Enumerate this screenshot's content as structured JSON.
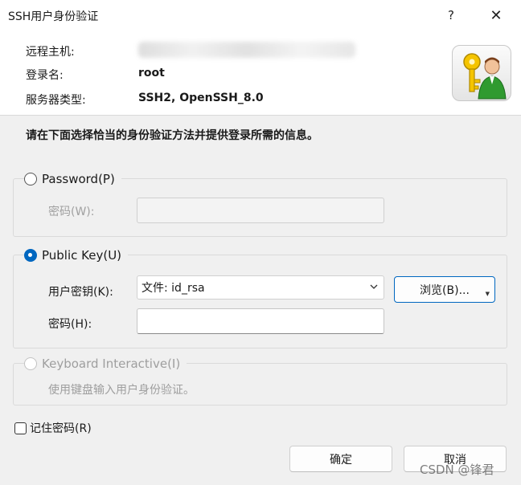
{
  "window": {
    "title": "SSH用户身份验证",
    "help_glyph": "?",
    "close_glyph": "✕"
  },
  "header": {
    "rows": [
      {
        "label": "远程主机:",
        "value": ""
      },
      {
        "label": "登录名:",
        "value": "root"
      },
      {
        "label": "服务器类型:",
        "value": "SSH2, OpenSSH_8.0"
      }
    ],
    "icon": "key-user-icon"
  },
  "instruction": "请在下面选择恰当的身份验证方法并提供登录所需的信息。",
  "password_group": {
    "label": "Password(P)",
    "field_label": "密码(W):",
    "selected": false,
    "enabled": false
  },
  "publickey_group": {
    "label": "Public Key(U)",
    "selected": true,
    "key_label": "用户密钥(K):",
    "key_value": "文件: id_rsa",
    "browse_label": "浏览(B)...",
    "passphrase_label": "密码(H):"
  },
  "keyboard_group": {
    "label": "Keyboard Interactive(I)",
    "description": "使用键盘输入用户身份验证。",
    "enabled": false
  },
  "remember": {
    "label": "记住密码(R)",
    "checked": false
  },
  "buttons": {
    "ok": "确定",
    "cancel": "取消"
  },
  "watermark": "CSDN @锋君",
  "colors": {
    "accent": "#0067c0",
    "disabled_text": "#9e9e9e"
  }
}
